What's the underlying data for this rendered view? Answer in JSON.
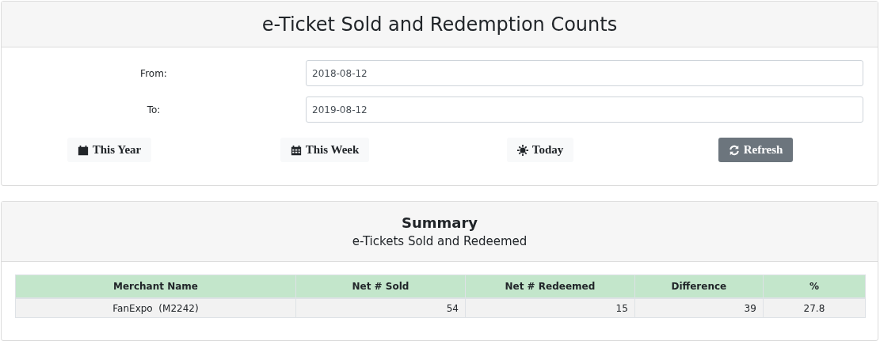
{
  "title": "e-Ticket Sold and Redemption Counts",
  "filters": [
    {
      "label": "From:",
      "value": "2018-08-12"
    },
    {
      "label": "To:",
      "value": "2019-08-12"
    }
  ],
  "buttons": [
    {
      "label": "This Year",
      "kind": "light"
    },
    {
      "label": "This Week",
      "kind": "light"
    },
    {
      "label": "Today",
      "kind": "light"
    },
    {
      "label": "Refresh",
      "kind": "secondary"
    }
  ],
  "summary": {
    "title": "Summary",
    "subtitle": "e-Tickets Sold and Redeemed",
    "table": {
      "columns": [
        "Merchant Name",
        "Net # Sold",
        "Net # Redeemed",
        "Difference",
        "%"
      ],
      "rows": [
        [
          "FanExpo  (M2242)",
          "54",
          "15",
          "39",
          "27.8"
        ]
      ]
    }
  }
}
